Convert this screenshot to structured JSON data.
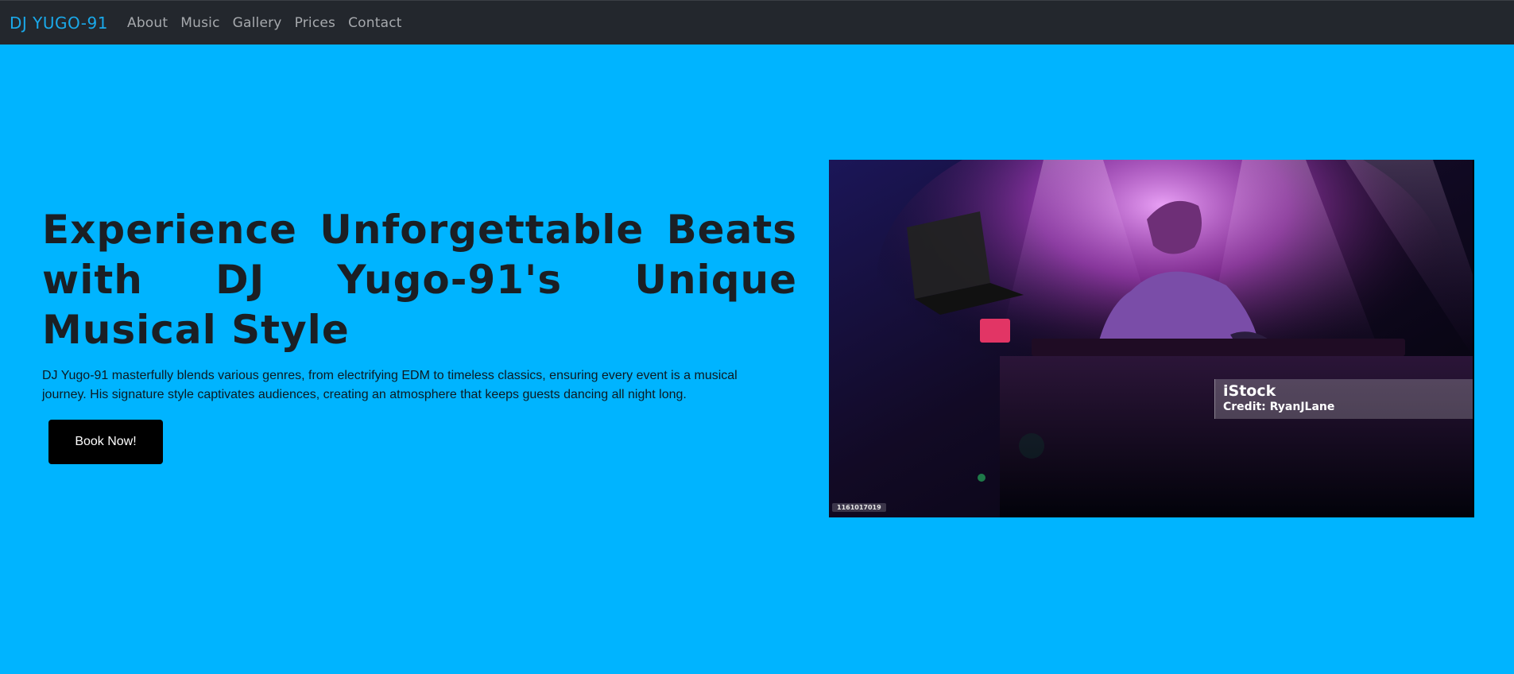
{
  "nav": {
    "brand": "DJ YUGO-91",
    "links": [
      "About",
      "Music",
      "Gallery",
      "Prices",
      "Contact"
    ]
  },
  "hero": {
    "headline": "Experience Unforgettable Beats with DJ Yugo-91's Unique Musical Style",
    "description": "DJ Yugo-91 masterfully blends various genres, from electrifying EDM to timeless classics, ensuring every event is a musical journey. His signature style captivates audiences, creating an atmosphere that keeps guests dancing all night long.",
    "button_label": "Book Now!"
  },
  "image": {
    "watermark_logo": "iStock",
    "watermark_credit": "Credit: RyanJLane",
    "stock_id": "1161017019"
  },
  "colors": {
    "nav_background": "#23272d",
    "brand": "#1aa9ea",
    "hero_background": "#00b4ff",
    "button_background": "#000000"
  }
}
